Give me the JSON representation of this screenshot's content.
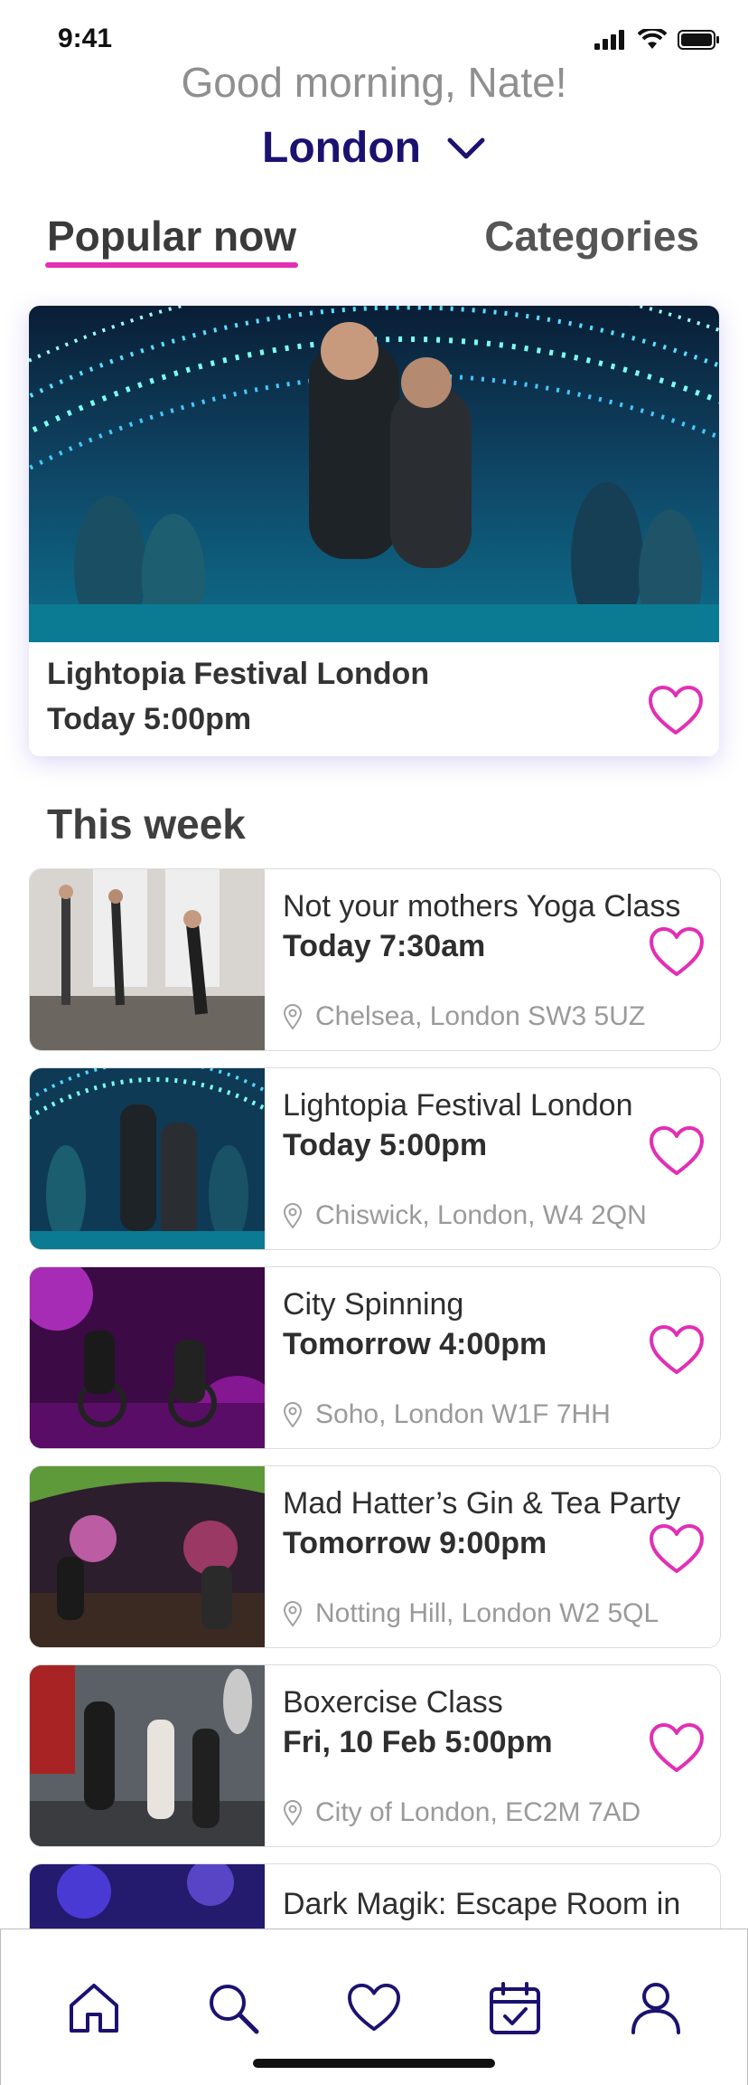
{
  "status_bar": {
    "time": "9:41"
  },
  "header": {
    "greeting": "Good morning, Nate!",
    "city": "London"
  },
  "tabs": [
    {
      "label": "Popular now",
      "active": true
    },
    {
      "label": "Categories",
      "active": false
    }
  ],
  "featured": {
    "title": "Lightopia Festival London",
    "time": "Today 5:00pm",
    "image": "light-festival-photo"
  },
  "section": {
    "title": "This week"
  },
  "events": [
    {
      "title": "Not your mothers Yoga Class",
      "time": "Today 7:30am",
      "location": "Chelsea, London SW3 5UZ",
      "image": "yoga-class-photo"
    },
    {
      "title": "Lightopia Festival London",
      "time": "Today 5:00pm",
      "location": "Chiswick, London, W4 2QN",
      "image": "light-festival-photo"
    },
    {
      "title": "City Spinning",
      "time": "Tomorrow 4:00pm",
      "location": "Soho, London W1F 7HH",
      "image": "spinning-class-photo"
    },
    {
      "title": "Mad Hatter’s Gin & Tea Party",
      "time": "Tomorrow 9:00pm",
      "location": "Notting Hill, London W2 5QL",
      "image": "tea-party-photo"
    },
    {
      "title": "Boxercise Class",
      "time": "Fri, 10 Feb 5:00pm",
      "location": "City of London, EC2M 7AD",
      "image": "boxercise-photo"
    },
    {
      "title": "Dark Magik: Escape Room in the Dark",
      "time": "",
      "location": "",
      "image": "escape-room-photo"
    }
  ],
  "bottom_nav": [
    "home-icon",
    "search-icon",
    "favorites-heart-icon",
    "calendar-check-icon",
    "profile-icon"
  ],
  "colors": {
    "accent_pink": "#e22fb4",
    "navy": "#1b1270",
    "text_gray": "#8f8f8f"
  }
}
